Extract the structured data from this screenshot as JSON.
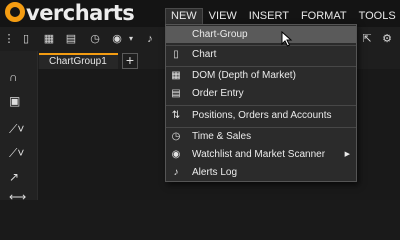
{
  "app": {
    "brand": "Overcharts",
    "brand_rest": "vercharts"
  },
  "menubar": {
    "items": [
      "NEW",
      "VIEW",
      "INSERT",
      "FORMAT",
      "TOOLS"
    ]
  },
  "tabs": {
    "active_label": "ChartGroup1",
    "add_label": "+"
  },
  "new_menu": {
    "items": [
      {
        "label": "Chart-Group",
        "icon": "none",
        "highlighted": true
      },
      {
        "label": "Chart",
        "icon": "candlestick-icon"
      },
      {
        "label": "DOM (Depth of Market)",
        "icon": "dom-grid-icon"
      },
      {
        "label": "Order Entry",
        "icon": "order-entry-icon"
      },
      {
        "label": "Positions, Orders and Accounts",
        "icon": "positions-icon"
      },
      {
        "label": "Time & Sales",
        "icon": "stopwatch-icon"
      },
      {
        "label": "Watchlist and Market Scanner",
        "icon": "eye-icon",
        "submenu": true
      },
      {
        "label": "Alerts Log",
        "icon": "bell-icon"
      }
    ]
  },
  "colors": {
    "accent": "#f39c12",
    "background": "#1a1a1a",
    "menu_bg": "#2b2b2b",
    "highlight": "#5a5a5a"
  }
}
